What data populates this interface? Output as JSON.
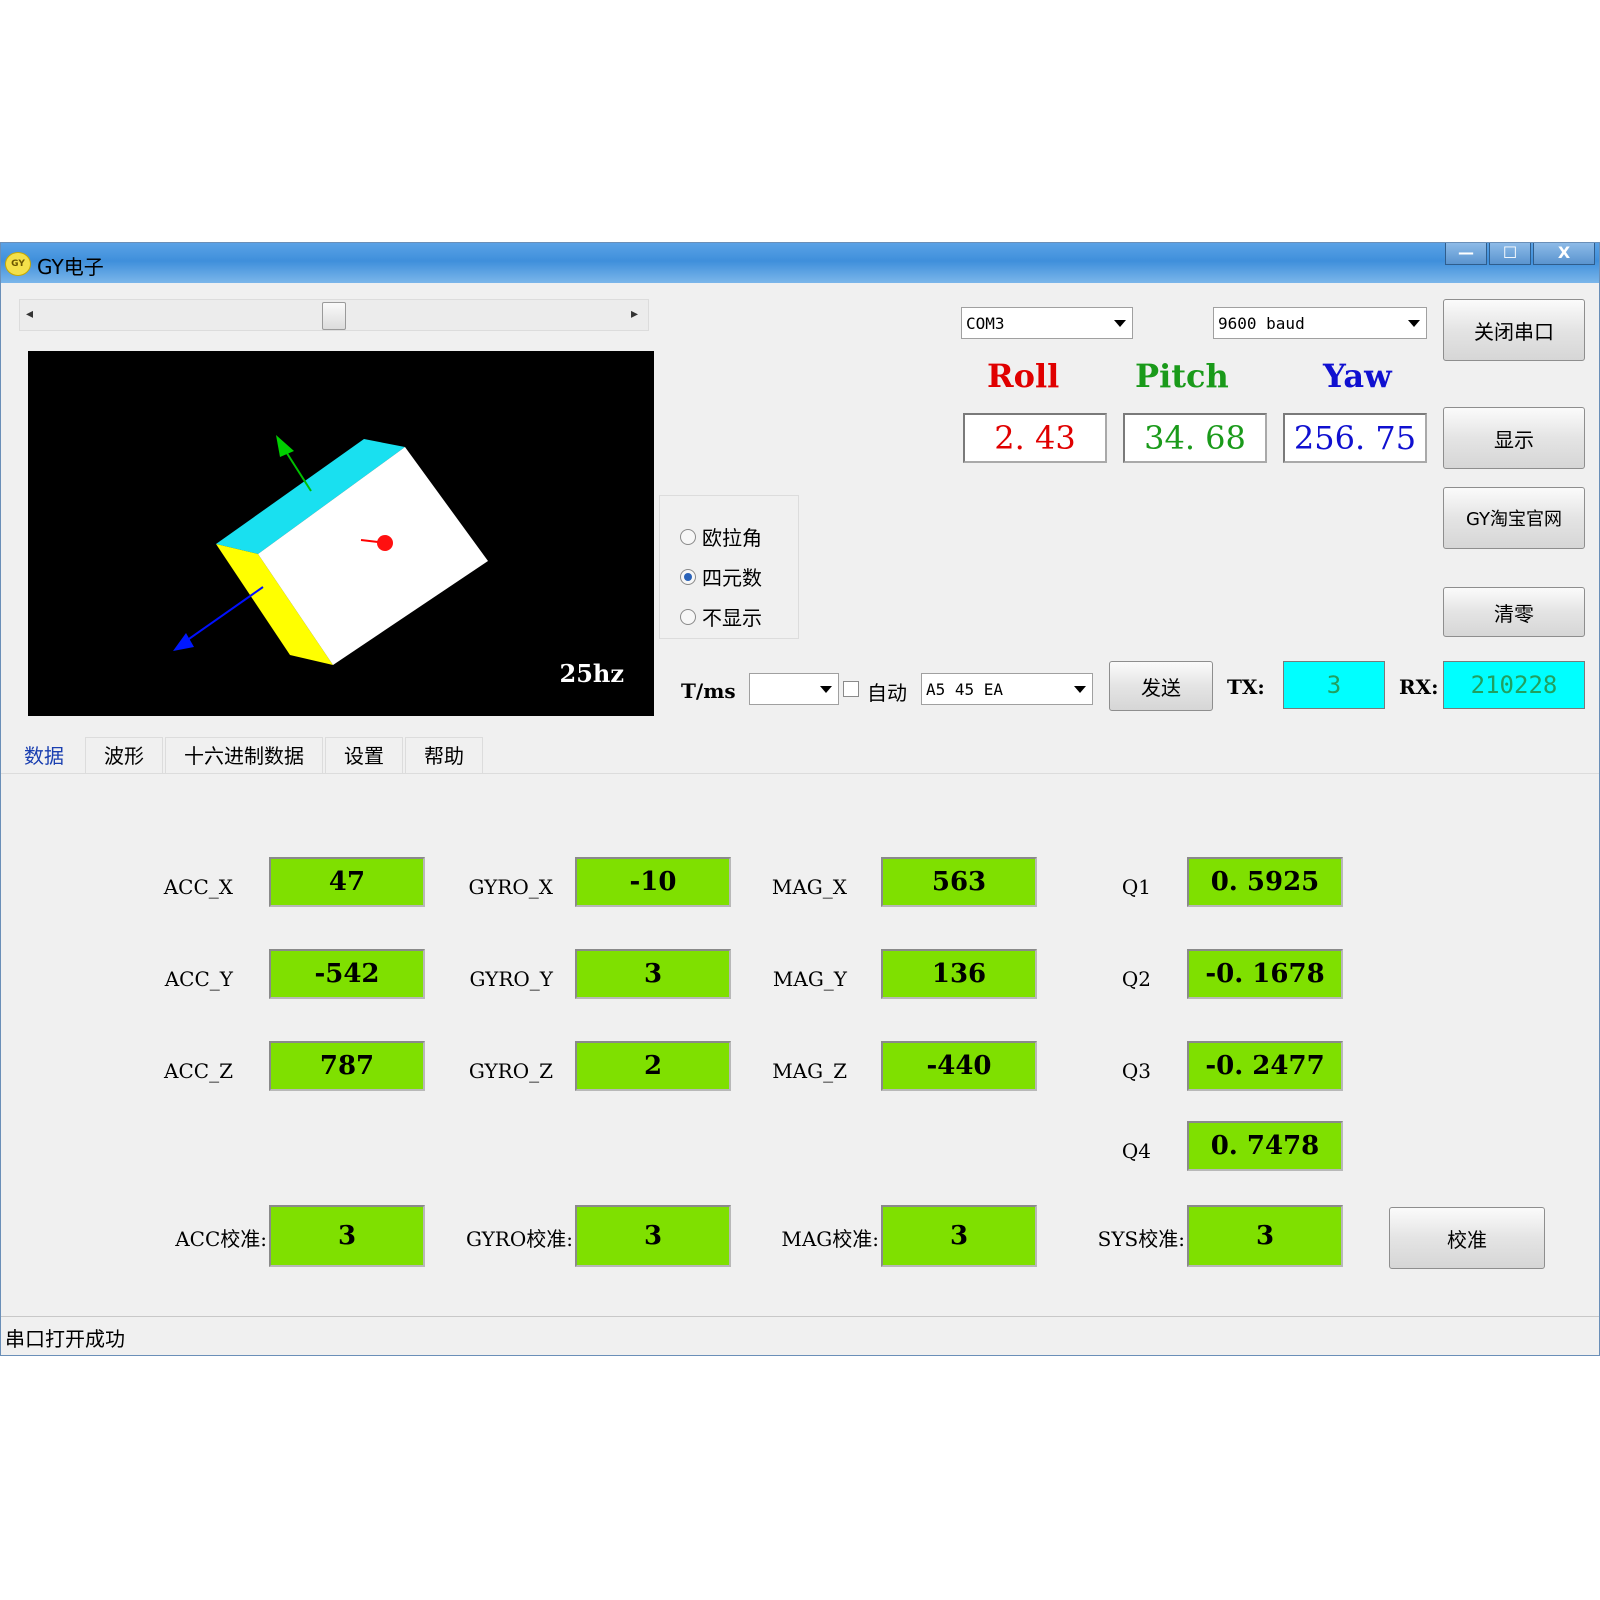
{
  "window": {
    "title": "GY电子",
    "logo_text": "GY",
    "min": "—",
    "max": "☐",
    "close": "X"
  },
  "slider": {
    "left_arrow": "◂",
    "right_arrow": "▸"
  },
  "view3d": {
    "rate": "25hz"
  },
  "serial": {
    "port": "COM3",
    "baud": "9600 baud",
    "close_button": "关闭串口"
  },
  "angles": {
    "roll_label": "Roll",
    "pitch_label": "Pitch",
    "yaw_label": "Yaw",
    "roll": "2. 43",
    "pitch": "34. 68",
    "yaw": "256. 75",
    "colors": {
      "roll": "#e00000",
      "pitch": "#1a9a1a",
      "yaw": "#1010d0"
    }
  },
  "buttons": {
    "display": "显示",
    "taobao": "GY淘宝官网",
    "clear": "清零",
    "send": "发送",
    "calibrate": "校准"
  },
  "display_mode": {
    "options": [
      "欧拉角",
      "四元数",
      "不显示"
    ],
    "selected": "四元数"
  },
  "send_row": {
    "period_label": "T/ms",
    "period_value": "",
    "auto_label": "自动",
    "command": "A5 45 EA",
    "tx_label": "TX:",
    "tx_value": "3",
    "rx_label": "RX:",
    "rx_value": "210228"
  },
  "tabs": [
    {
      "label": "数据",
      "active": true
    },
    {
      "label": "波形"
    },
    {
      "label": "十六进制数据"
    },
    {
      "label": "设置"
    },
    {
      "label": "帮助"
    }
  ],
  "data": {
    "acc_x_label": "ACC_X",
    "acc_x": "47",
    "acc_y_label": "ACC_Y",
    "acc_y": "-542",
    "acc_z_label": "ACC_Z",
    "acc_z": "787",
    "gyro_x_label": "GYRO_X",
    "gyro_x": "-10",
    "gyro_y_label": "GYRO_Y",
    "gyro_y": "3",
    "gyro_z_label": "GYRO_Z",
    "gyro_z": "2",
    "mag_x_label": "MAG_X",
    "mag_x": "563",
    "mag_y_label": "MAG_Y",
    "mag_y": "136",
    "mag_z_label": "MAG_Z",
    "mag_z": "-440",
    "q1_label": "Q1",
    "q1": "0. 5925",
    "q2_label": "Q2",
    "q2": "-0. 1678",
    "q3_label": "Q3",
    "q3": "-0. 2477",
    "q4_label": "Q4",
    "q4": "0. 7478",
    "acc_cal_label": "ACC校准:",
    "acc_cal": "3",
    "gyro_cal_label": "GYRO校准:",
    "gyro_cal": "3",
    "mag_cal_label": "MAG校准:",
    "mag_cal": "3",
    "sys_cal_label": "SYS校准:",
    "sys_cal": "3"
  },
  "status": {
    "message": "串口打开成功"
  }
}
